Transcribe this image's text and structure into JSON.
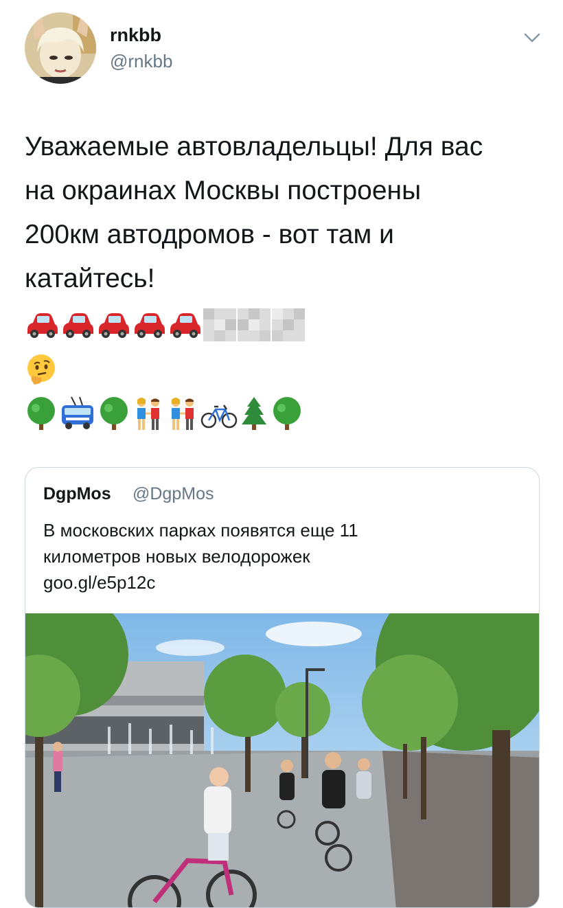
{
  "tweet": {
    "author": {
      "display_name": "rnkbb",
      "handle": "@rnkbb"
    },
    "text_lines": [
      "Уважаемые автовладельцы! Для вас",
      "на окраинах Москвы построены",
      "200км автодромов - вот там и",
      "катайтесь!"
    ],
    "emoji_rows": [
      [
        "car-icon",
        "car-icon",
        "car-icon",
        "car-icon",
        "car-icon",
        "censored-block-icon",
        "censored-block-icon",
        "censored-block-icon"
      ],
      [
        "thinking-face-icon"
      ],
      [
        "tree-icon",
        "trolleybus-icon",
        "tree-icon",
        "couple-icon",
        "couple-icon",
        "bicycle-icon",
        "evergreen-tree-icon",
        "tree-icon"
      ]
    ]
  },
  "quoted_tweet": {
    "author": {
      "display_name": "DgpMos",
      "handle": "@DgpMos"
    },
    "text_lines": [
      "В московских парках появятся еще 11",
      "километров новых велодорожек",
      "goo.gl/e5p12c"
    ],
    "image": "park-bike-path-photo"
  },
  "colors": {
    "text": "#14171a",
    "secondary": "#657786",
    "border": "#ccd6dd"
  }
}
